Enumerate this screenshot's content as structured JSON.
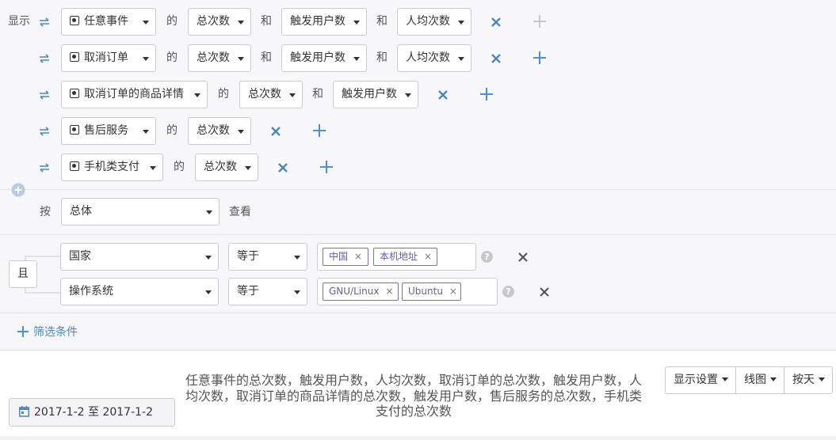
{
  "display_label": "显示",
  "connector_of": "的",
  "connector_and": "和",
  "metric_rows": [
    {
      "event": "任意事件",
      "metrics": [
        "总次数",
        "触发用户数",
        "人均次数"
      ]
    },
    {
      "event": "取消订单",
      "metrics": [
        "总次数",
        "触发用户数",
        "人均次数"
      ]
    },
    {
      "event": "取消订单的商品详情",
      "metrics": [
        "总次数",
        "触发用户数"
      ]
    },
    {
      "event": "售后服务",
      "metrics": [
        "总次数"
      ]
    },
    {
      "event": "手机类支付",
      "metrics": [
        "总次数"
      ]
    }
  ],
  "group_by": {
    "prefix": "按",
    "value": "总体",
    "suffix": "查看"
  },
  "filter": {
    "logic": "且",
    "conditions": [
      {
        "property": "国家",
        "operator": "等于",
        "values": [
          "中国",
          "本机地址"
        ]
      },
      {
        "property": "操作系统",
        "operator": "等于",
        "values": [
          "GNU/Linux",
          "Ubuntu"
        ]
      }
    ],
    "add_label": "筛选条件"
  },
  "chart_header": {
    "date_range": "2017-1-2 至 2017-1-2",
    "title": "任意事件的总次数，触发用户数，人均次数，取消订单的总次数，触发用户数，人均次数，取消订单的商品详情的总次数，触发用户数，售后服务的总次数，手机类支付的总次数",
    "buttons": [
      "显示设置",
      "线图",
      "按天"
    ]
  },
  "colors": {
    "accent": "#4a90e2",
    "tag": "#6a5aab",
    "remove": "#4a86c8"
  }
}
